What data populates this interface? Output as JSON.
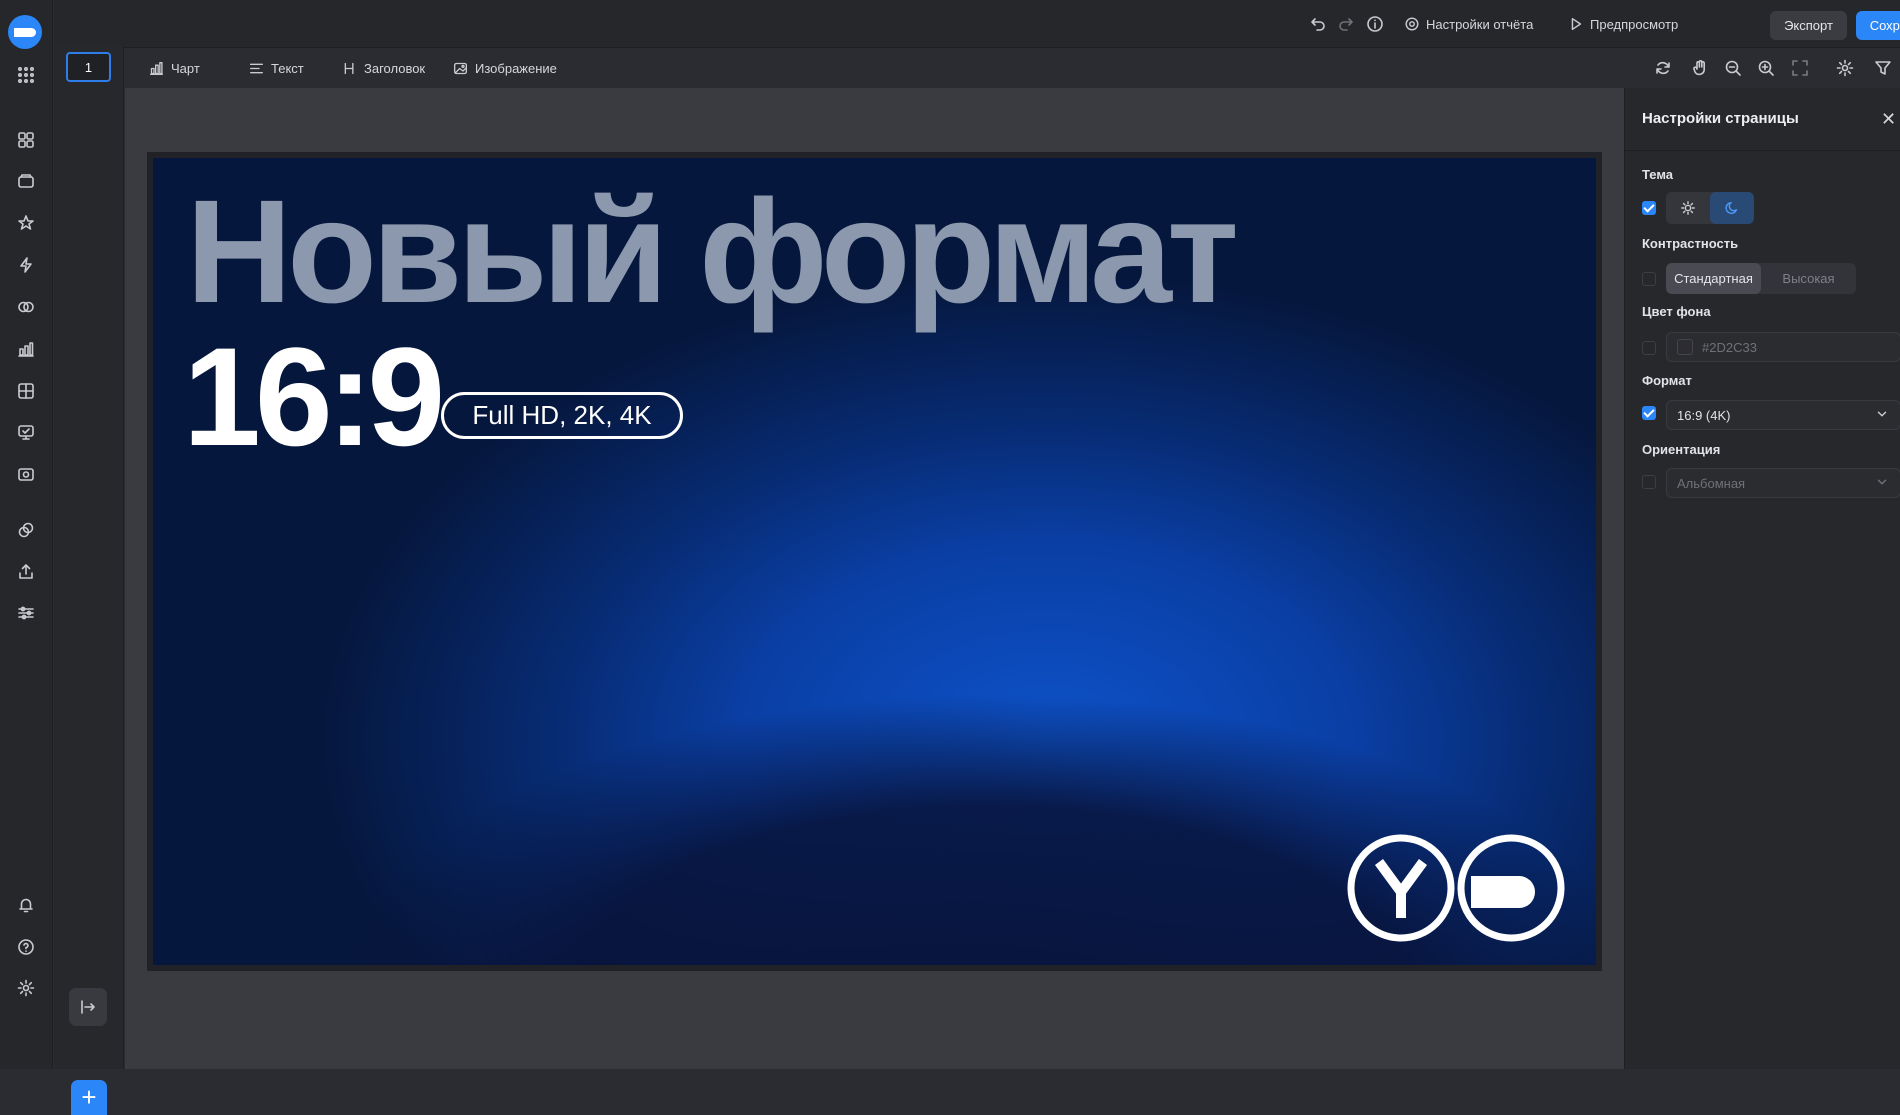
{
  "topbar": {
    "report_settings": "Настройки отчёта",
    "preview": "Предпросмотр",
    "export": "Экспорт",
    "save": "Сохранить"
  },
  "pages": {
    "current": "1"
  },
  "insert": {
    "chart": "Чарт",
    "text": "Текст",
    "heading": "Заголовок",
    "image": "Изображение"
  },
  "slide": {
    "title": "Новый формат",
    "ratio": "16:9",
    "badge": "Full HD, 2K, 4K"
  },
  "panel": {
    "title": "Настройки страницы",
    "theme_label": "Тема",
    "contrast_label": "Контрастность",
    "contrast_options": [
      "Стандартная",
      "Высокая"
    ],
    "bg_color_label": "Цвет фона",
    "bg_color_value": "#2D2C33",
    "format_label": "Формат",
    "format_value": "16:9 (4K)",
    "orientation_label": "Ориентация",
    "orientation_value": "Альбомная"
  },
  "colors": {
    "accent": "#2B86F7",
    "app_bg": "#2B2C31",
    "slide_bg": "#06173D"
  }
}
